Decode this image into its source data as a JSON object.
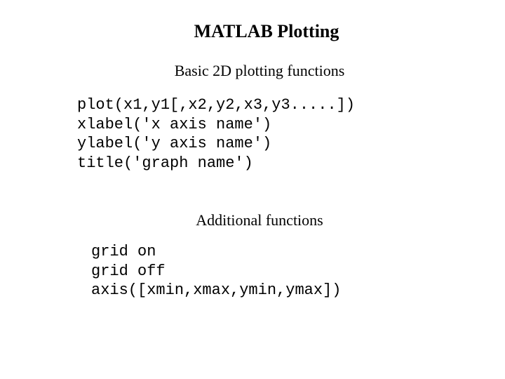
{
  "title": "MATLAB Plotting",
  "section1": {
    "heading": "Basic 2D plotting functions",
    "code": "plot(x1,y1[,x2,y2,x3,y3.....])\nxlabel('x axis name')\nylabel('y axis name')\ntitle('graph name')"
  },
  "section2": {
    "heading": "Additional functions",
    "code": "grid on\ngrid off\naxis([xmin,xmax,ymin,ymax])"
  }
}
